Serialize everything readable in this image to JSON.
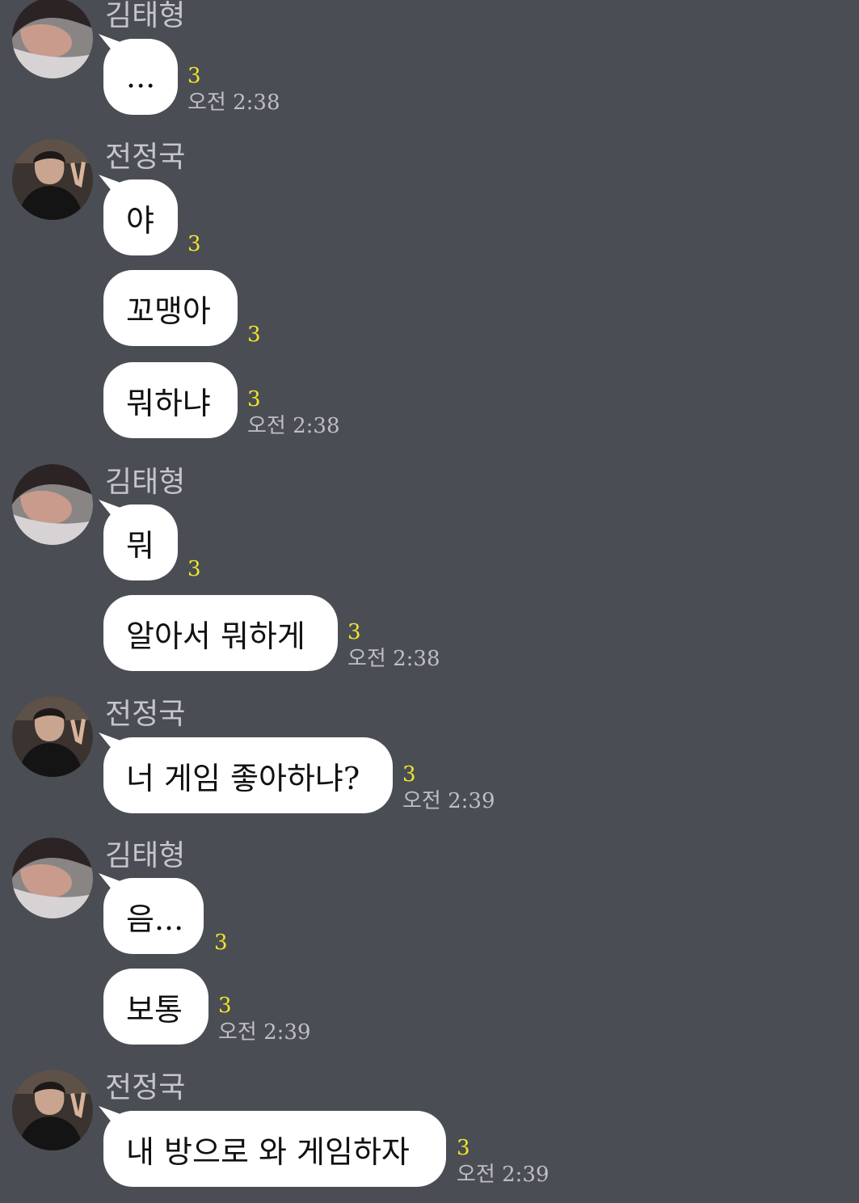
{
  "groups": [
    {
      "sender": "김태형",
      "avatar": "profile-photo-taehyung",
      "messages": [
        {
          "text": "...",
          "unread": "3",
          "time": "오전 2:38"
        }
      ]
    },
    {
      "sender": "전정국",
      "avatar": "profile-photo-jungkook",
      "messages": [
        {
          "text": "야",
          "unread": "3"
        },
        {
          "text": "꼬맹아",
          "unread": "3"
        },
        {
          "text": "뭐하냐",
          "unread": "3",
          "time": "오전 2:38"
        }
      ]
    },
    {
      "sender": "김태형",
      "avatar": "profile-photo-taehyung",
      "messages": [
        {
          "text": "뭐",
          "unread": "3"
        },
        {
          "text": "알아서 뭐하게",
          "unread": "3",
          "time": "오전 2:38"
        }
      ]
    },
    {
      "sender": "전정국",
      "avatar": "profile-photo-jungkook",
      "messages": [
        {
          "text": "너 게임 좋아하냐?",
          "unread": "3",
          "time": "오전 2:39"
        }
      ]
    },
    {
      "sender": "김태형",
      "avatar": "profile-photo-taehyung",
      "messages": [
        {
          "text": "음...",
          "unread": "3"
        },
        {
          "text": "보통",
          "unread": "3",
          "time": "오전 2:39"
        }
      ]
    },
    {
      "sender": "전정국",
      "avatar": "profile-photo-jungkook",
      "messages": [
        {
          "text": "내 방으로 와 게임하자",
          "unread": "3",
          "time": "오전 2:39"
        }
      ]
    }
  ],
  "colors": {
    "background": "#4a4d54",
    "bubble": "#ffffff",
    "unread": "#f0e52a",
    "meta_text": "#bdbfc4"
  }
}
